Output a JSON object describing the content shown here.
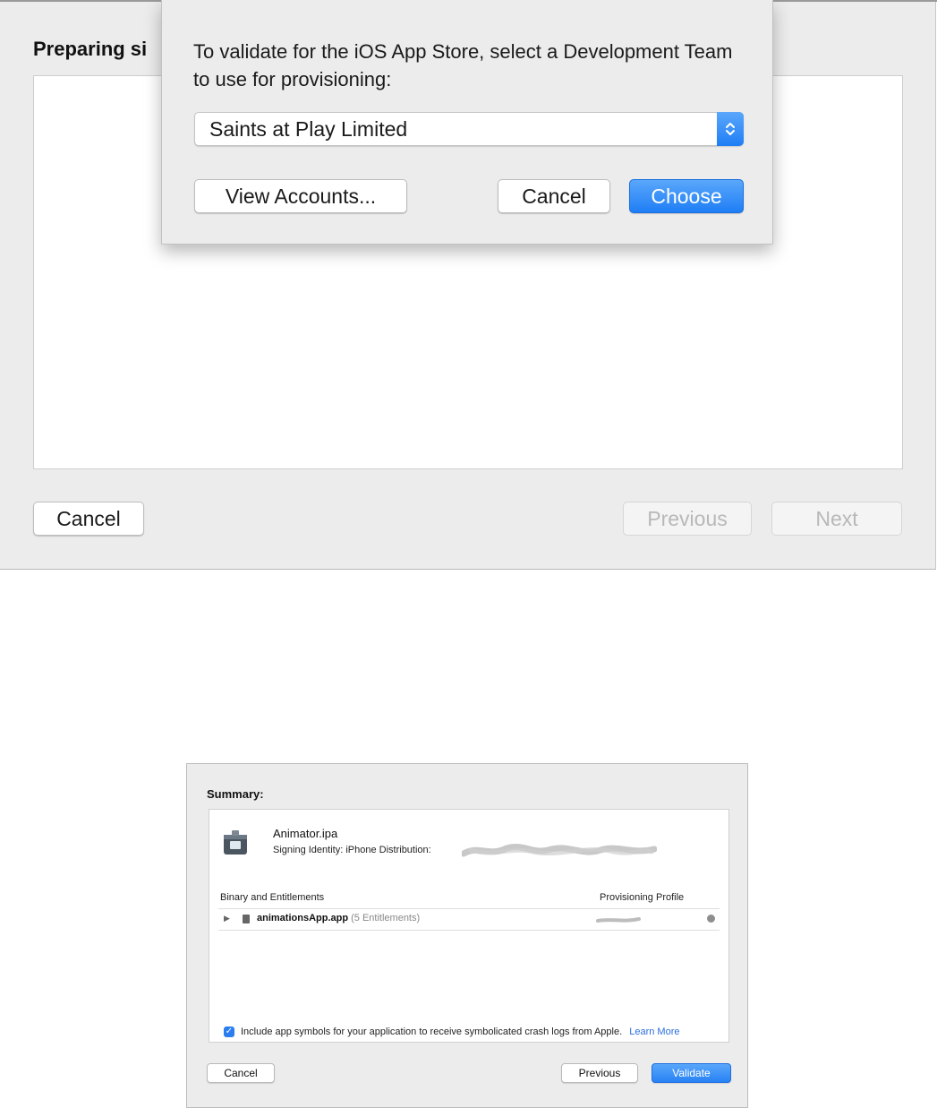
{
  "top_window": {
    "heading": "Preparing si",
    "buttons": {
      "cancel": "Cancel",
      "previous": "Previous",
      "next": "Next"
    }
  },
  "sheet": {
    "prompt": "To validate for the iOS App Store, select a Development Team to use for provisioning:",
    "team_popup": {
      "selected": "Saints at Play Limited"
    },
    "buttons": {
      "view_accounts": "View Accounts...",
      "cancel": "Cancel",
      "choose": "Choose"
    }
  },
  "summary_window": {
    "title": "Summary:",
    "ipa_name": "Animator.ipa",
    "signing_identity_label": "Signing Identity: iPhone Distribution:",
    "columns": {
      "left": "Binary and Entitlements",
      "right": "Provisioning Profile"
    },
    "rows": [
      {
        "name": "animationsApp.app",
        "detail": "(5 Entitlements)"
      }
    ],
    "include_symbols": {
      "checked": true,
      "label": "Include app symbols for your application to receive symbolicated crash logs from Apple.",
      "link": "Learn More"
    },
    "buttons": {
      "cancel": "Cancel",
      "previous": "Previous",
      "validate": "Validate"
    }
  },
  "icons": [
    "disclosure-triangle-icon",
    "app-file-icon",
    "chevron-up-down-icon",
    "go-arrow-icon",
    "checkmark-icon"
  ],
  "colors": {
    "accent": "#1f7ef5",
    "link": "#2a6fdb",
    "window_bg": "#ececec"
  }
}
